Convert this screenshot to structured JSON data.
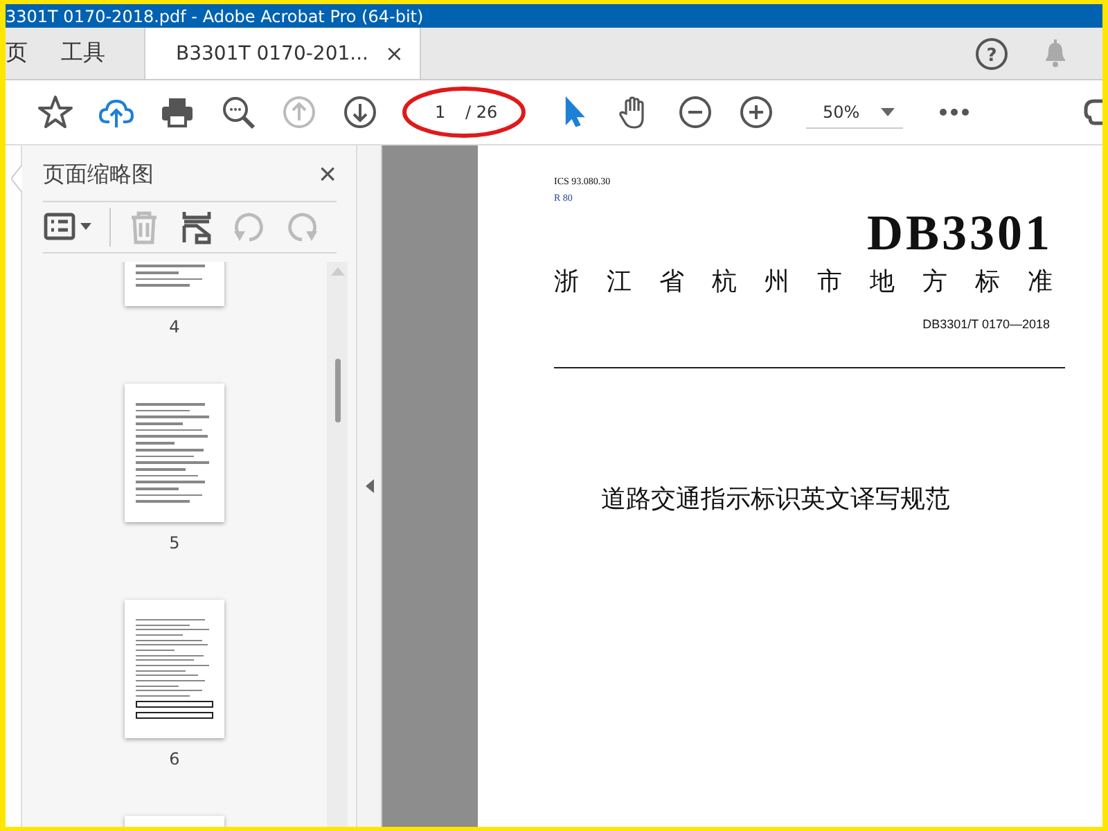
{
  "window": {
    "title": "3301T 0170-2018.pdf - Adobe Acrobat Pro (64-bit)"
  },
  "tabs": [
    {
      "label": "页",
      "selected": false
    },
    {
      "label": "工具",
      "selected": false
    },
    {
      "label": "B3301T 0170-201...",
      "selected": true,
      "close": "×"
    }
  ],
  "help": "?",
  "toolbar": {
    "tools_left": [
      {
        "kind": "star",
        "disabled": false
      },
      {
        "kind": "upload",
        "disabled": false
      },
      {
        "kind": "print",
        "disabled": false
      },
      {
        "kind": "find",
        "disabled": false
      },
      {
        "kind": "prev",
        "disabled": true
      },
      {
        "kind": "next",
        "disabled": false
      }
    ],
    "page_current": "1",
    "page_total": "/ 26",
    "tools_right": [
      {
        "kind": "pointer",
        "selected": true
      },
      {
        "kind": "hand",
        "selected": false
      },
      {
        "kind": "zoom-out",
        "selected": false
      },
      {
        "kind": "zoom-in",
        "selected": false
      }
    ],
    "zoom": "50%"
  },
  "panel": {
    "title": "页面缩略图",
    "close": "×",
    "tools": [
      {
        "kind": "options",
        "disabled": false
      },
      {
        "kind": "delete",
        "disabled": true
      },
      {
        "kind": "extract",
        "disabled": false
      },
      {
        "kind": "rotate-left",
        "disabled": true
      },
      {
        "kind": "rotate-right",
        "disabled": true
      }
    ],
    "thumbnails": [
      {
        "label": "4",
        "kind": "text"
      },
      {
        "label": "5",
        "kind": "text"
      },
      {
        "label": "6",
        "kind": "table"
      }
    ]
  },
  "document": {
    "ics": "ICS 93.080.30",
    "ccs": "R 80",
    "code": "DB3301",
    "issuer": "浙江省杭州市地方标准",
    "number": "DB3301/T 0170—2018",
    "title": "道路交通指示标识英文译写规范"
  }
}
